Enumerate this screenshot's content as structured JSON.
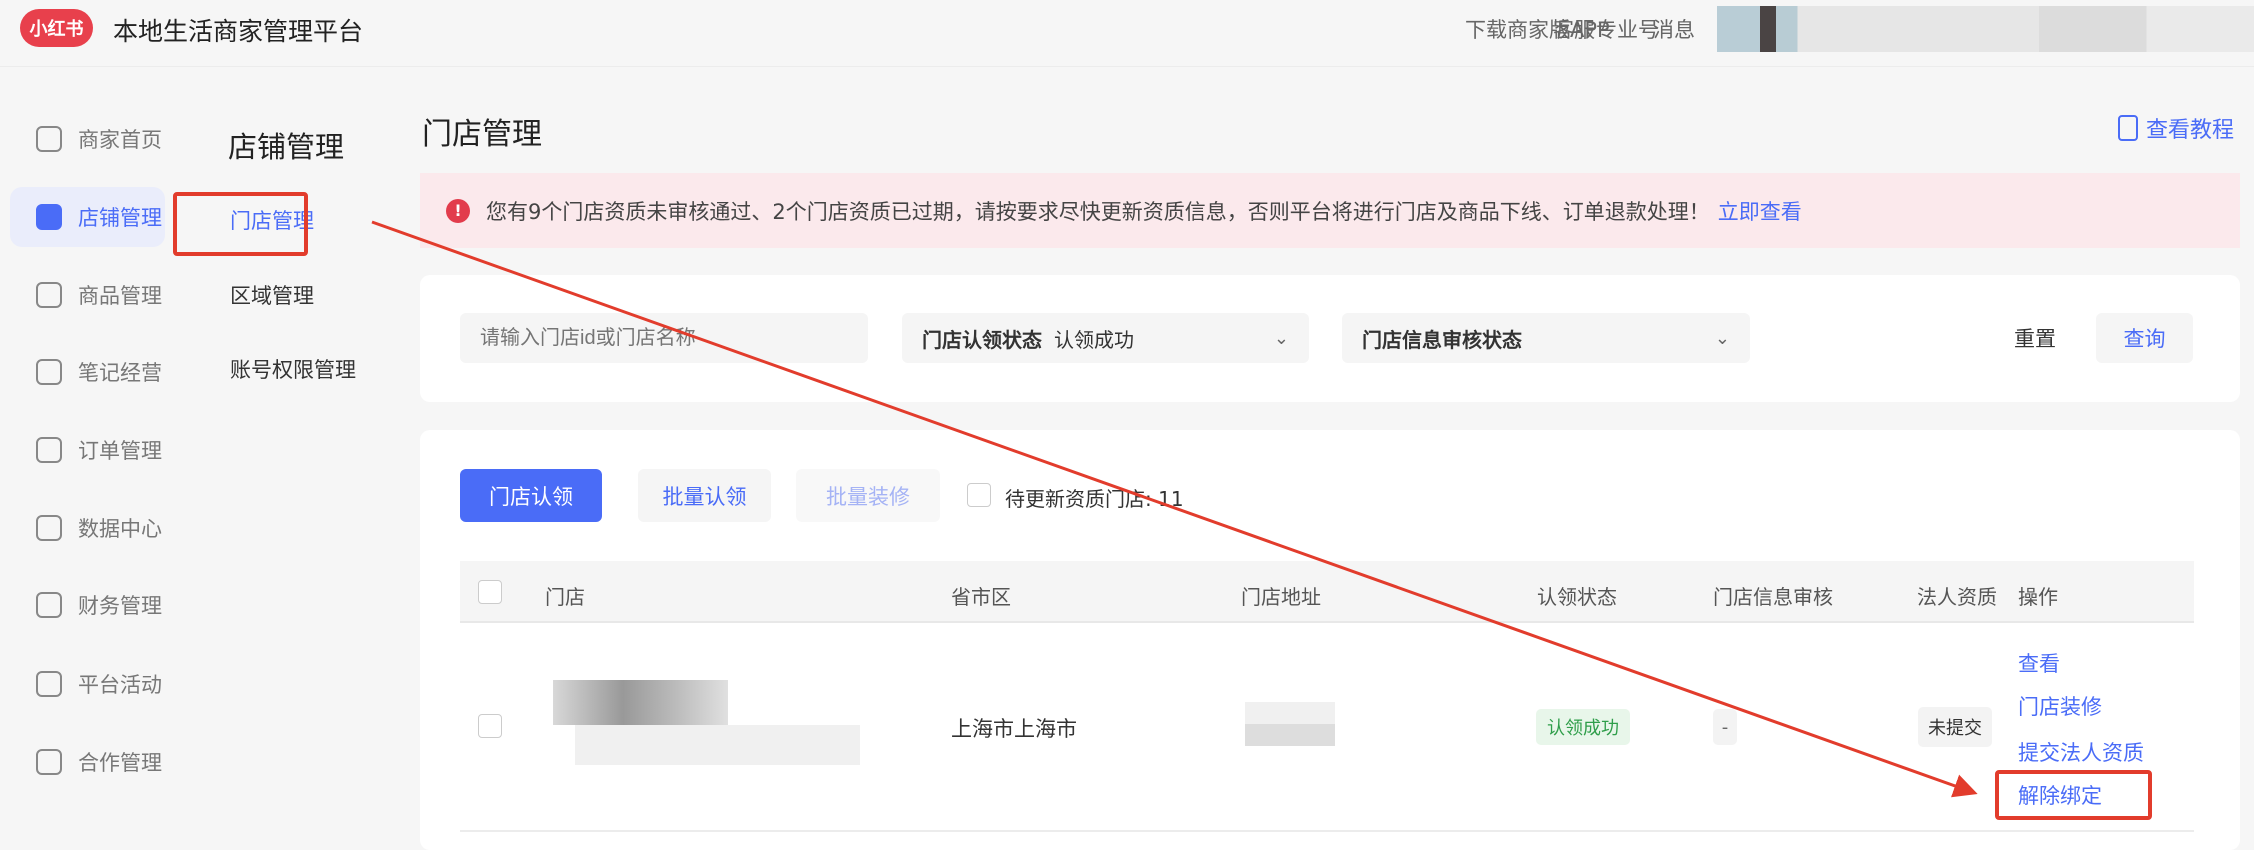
{
  "header": {
    "logo": "小红书",
    "title": "本地生活商家管理平台",
    "links": [
      "下载商家版APP",
      "客服",
      "专业号",
      "消息"
    ]
  },
  "sidebar": {
    "items": [
      {
        "label": "商家首页"
      },
      {
        "label": "店铺管理",
        "active": true
      },
      {
        "label": "商品管理"
      },
      {
        "label": "笔记经营"
      },
      {
        "label": "订单管理"
      },
      {
        "label": "数据中心"
      },
      {
        "label": "财务管理"
      },
      {
        "label": "平台活动"
      },
      {
        "label": "合作管理"
      }
    ]
  },
  "subnav": {
    "title": "店铺管理",
    "items": [
      {
        "label": "门店管理",
        "active": true
      },
      {
        "label": "区域管理"
      },
      {
        "label": "账号权限管理"
      }
    ]
  },
  "main": {
    "title": "门店管理",
    "tutorial": "查看教程",
    "alert": {
      "text": "您有9个门店资质未审核通过、2个门店资质已过期，请按要求尽快更新资质信息，否则平台将进行门店及商品下线、订单退款处理！",
      "link": "立即查看"
    },
    "filters": {
      "search_placeholder": "请输入门店id或门店名称",
      "claim_label": "门店认领状态",
      "claim_value": "认领成功",
      "audit_label": "门店信息审核状态",
      "reset": "重置",
      "query": "查询"
    },
    "actions": {
      "claim": "门店认领",
      "batch_claim": "批量认领",
      "batch_decorate": "批量装修",
      "pending_label": "待更新资质门店: 11"
    },
    "table": {
      "columns": [
        "门店",
        "省市区",
        "门店地址",
        "认领状态",
        "门店信息审核",
        "法人资质",
        "操作"
      ],
      "rows": [
        {
          "region": "上海市上海市",
          "claim_status": "认领成功",
          "audit": "-",
          "legal": "未提交",
          "ops": [
            "查看",
            "门店装修",
            "提交法人资质",
            "解除绑定"
          ]
        }
      ]
    }
  },
  "colors": {
    "accent": "#4a6cf7",
    "annotation": "#e23c2c"
  }
}
